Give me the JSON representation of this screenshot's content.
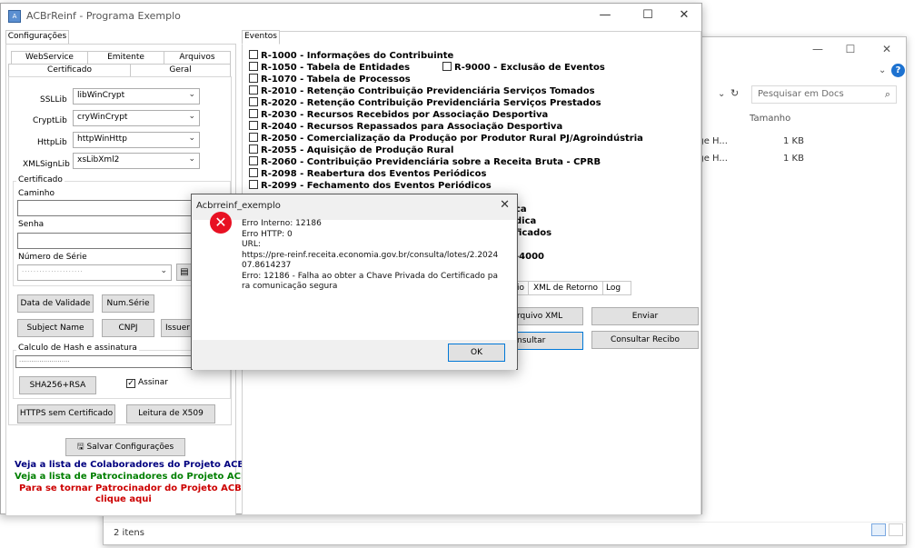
{
  "explorer": {
    "search_placeholder": "Pesquisar em Docs",
    "column_size": "Tamanho",
    "files": [
      {
        "name_fragment": "dge H...",
        "size": "1 KB"
      },
      {
        "name_fragment": "dge H...",
        "size": "1 KB"
      }
    ],
    "status": "2 itens",
    "help_label": "?"
  },
  "main": {
    "title": "ACBrReinf - Programa Exemplo",
    "config": {
      "tab_label": "Configurações",
      "subtabs_top": [
        "WebService",
        "Emitente",
        "Arquivos"
      ],
      "subtabs_bottom": [
        "Certificado",
        "Geral"
      ],
      "fields": [
        {
          "label": "SSLLib",
          "value": "libWinCrypt"
        },
        {
          "label": "CryptLib",
          "value": "cryWinCrypt"
        },
        {
          "label": "HttpLib",
          "value": "httpWinHttp"
        },
        {
          "label": "XMLSignLib",
          "value": "xsLibXml2"
        }
      ],
      "cert_group": "Certificado",
      "caminho_label": "Caminho",
      "senha_label": "Senha",
      "numserie_label": "Número de Série",
      "btn_data_validade": "Data de Validade",
      "btn_num_serie": "Num.Série",
      "btn_subject": "Subject Name",
      "btn_cnpj": "CNPJ",
      "btn_issuer": "Issuer N",
      "hash_group": "Calculo de Hash e assinatura",
      "btn_sha": "SHA256+RSA",
      "assinar_label": "Assinar",
      "btn_https": "HTTPS sem Certificado",
      "btn_x509": "Leitura de X509",
      "btn_salvar": "Salvar Configurações",
      "link_colab": "Veja a lista de Colaboradores do Projeto ACBr",
      "link_patro": "Veja a lista de Patrocinadores do Projeto ACBr",
      "link_torne1": "Para se tornar Patrocinador do Projeto ACBr,",
      "link_torne2": "clique aqui",
      "colors": {
        "colab": "#00007f",
        "patro": "#007f00",
        "torne": "#cc0000"
      }
    },
    "eventos": {
      "group_label": "Eventos",
      "items": [
        "R-1000 - Informações do Contribuinte",
        "R-1050 - Tabela de Entidades",
        "R-1070 - Tabela de Processos",
        "R-2010 - Retenção Contribuição Previdenciária  Serviços Tomados",
        "R-2020 - Retenção Contribuição Previdenciária  Serviços Prestados",
        "R-2030 - Recursos Recebidos por Associação Desportiva",
        "R-2040 - Recursos Repassados para Associação Desportiva",
        "R-2050 - Comercialização da Produção por Produtor Rural PJ/Agroindústria",
        "R-2055 - Aquisição de Produção Rural",
        "R-2060 - Contribuição Previdenciária sobre a Receita Bruta - CPRB",
        "R-2098 - Reabertura dos Eventos Periódicos",
        "R-2099 - Fechamento dos Eventos Periódicos"
      ],
      "r9000": "R-9000 - Exclusão de Eventos",
      "partial": [
        "ca",
        "dica",
        "ficados"
      ],
      "partial_4000": "-4000",
      "tabs": [
        "io",
        "XML de Retorno",
        "Log"
      ],
      "btn_arquivo_xml": "rquivo XML",
      "btn_enviar": "Enviar",
      "btn_consultar": "nsultar",
      "btn_consultar_recibo": "Consultar Recibo"
    }
  },
  "dialog": {
    "title": "Acbrreinf_exemplo",
    "message": "Erro Interno: 12186\nErro HTTP: 0\nURL:\nhttps://pre-reinf.receita.economia.gov.br/consulta/lotes/2.202407.8614237\nErro: 12186 - Falha ao obter a Chave Privada do Certificado para comunicação segura",
    "ok_label": "OK",
    "icon": "error-icon"
  }
}
